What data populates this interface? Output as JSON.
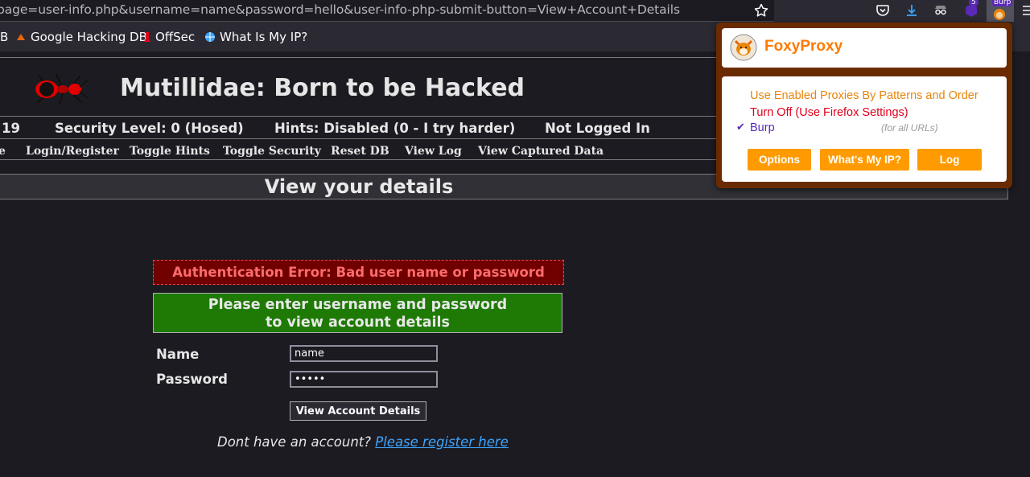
{
  "browser": {
    "url": "page=user-info.php&username=name&password=hello&user-info-php-submit-button=View+Account+Details",
    "toolbar_badges": {
      "extension_count": "5",
      "foxyproxy_badge": "Burp"
    },
    "bookmarks": [
      {
        "label": "B",
        "icon": "bookmark-icon"
      },
      {
        "label": "Google Hacking DB",
        "icon": "exploit-db-icon"
      },
      {
        "label": "OffSec",
        "icon": "offsec-icon"
      },
      {
        "label": "What Is My IP?",
        "icon": "globe-icon"
      }
    ]
  },
  "site": {
    "title": "Mutillidae: Born to be Hacked",
    "status": {
      "version_tail": "19",
      "security_level": "Security Level: 0 (Hosed)",
      "hints": "Hints: Disabled (0 - I try harder)",
      "login_status": "Not Logged In"
    },
    "menu": [
      "e",
      "Login/Register",
      "Toggle Hints",
      "Toggle Security",
      "Reset DB",
      "View Log",
      "View Captured Data"
    ]
  },
  "main": {
    "heading": "View your details",
    "auth_error": "Authentication Error: Bad user name or password",
    "banner_line1": "Please enter username and password",
    "banner_line2": "to view account details",
    "name_label": "Name",
    "name_value": "name",
    "password_label": "Password",
    "password_value": "hello",
    "submit_label": "View Account Details",
    "register_prompt": "Dont have an account?",
    "register_link": "Please register here"
  },
  "foxyproxy": {
    "title": "FoxyProxy",
    "options": [
      {
        "label": "Use Enabled Proxies By Patterns and Order",
        "color": "#e8850c"
      },
      {
        "label": "Turn Off (Use Firefox Settings)",
        "color": "#e0001b"
      },
      {
        "label": "Burp",
        "color": "#5a29b6",
        "selected": true,
        "note": "(for all URLs)"
      }
    ],
    "check_mark": "✔",
    "buttons": [
      "Options",
      "What's My IP?",
      "Log"
    ]
  }
}
